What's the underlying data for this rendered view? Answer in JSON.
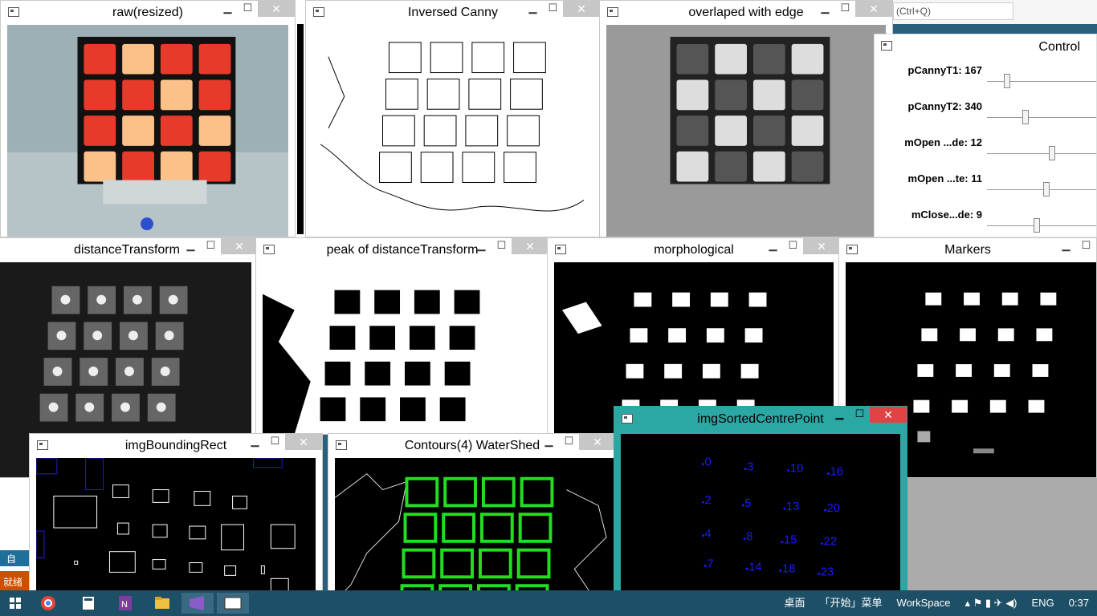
{
  "windows": {
    "raw": {
      "title": "raw(resized)"
    },
    "canny": {
      "title": "Inversed Canny"
    },
    "overlap": {
      "title": "overlaped with edge"
    },
    "control": {
      "title": "Control"
    },
    "dist": {
      "title": "distanceTransform"
    },
    "peak": {
      "title": "peak of distanceTransform"
    },
    "morph": {
      "title": "morphological"
    },
    "markers": {
      "title": "Markers"
    },
    "bbox": {
      "title": "imgBoundingRect"
    },
    "contours": {
      "title": "Contours(4) WaterShed"
    },
    "sorted": {
      "title": "imgSortedCentrePoint"
    }
  },
  "search": {
    "placeholder": "(Ctrl+Q)"
  },
  "control_sliders": [
    {
      "label": "pCannyT1: 167",
      "value": 167,
      "max": 1000
    },
    {
      "label": "pCannyT2: 340",
      "value": 340,
      "max": 1000
    },
    {
      "label": "mOpen ...de: 12",
      "value": 12,
      "max": 20
    },
    {
      "label": "mOpen ...te: 11",
      "value": 11,
      "max": 20
    },
    {
      "label": "mClose...de: 9",
      "value": 9,
      "max": 20
    }
  ],
  "centre_points": [
    "0",
    "3",
    "10",
    "16",
    "2",
    "5",
    "13",
    "20",
    "4",
    "8",
    "15",
    "22",
    "7",
    "14",
    "18",
    "23"
  ],
  "vs_labels": {
    "auto": "自动",
    "ready": "就绪"
  },
  "taskbar": {
    "items": [
      "桌面",
      "「开始」菜单",
      "WorkSpace"
    ],
    "lang": "ENG",
    "time": "0:37"
  },
  "colors": {
    "accent": "#2ba7a4",
    "close_active": "#e04343",
    "contour": "#22dd22",
    "points": "#1a1aff"
  }
}
